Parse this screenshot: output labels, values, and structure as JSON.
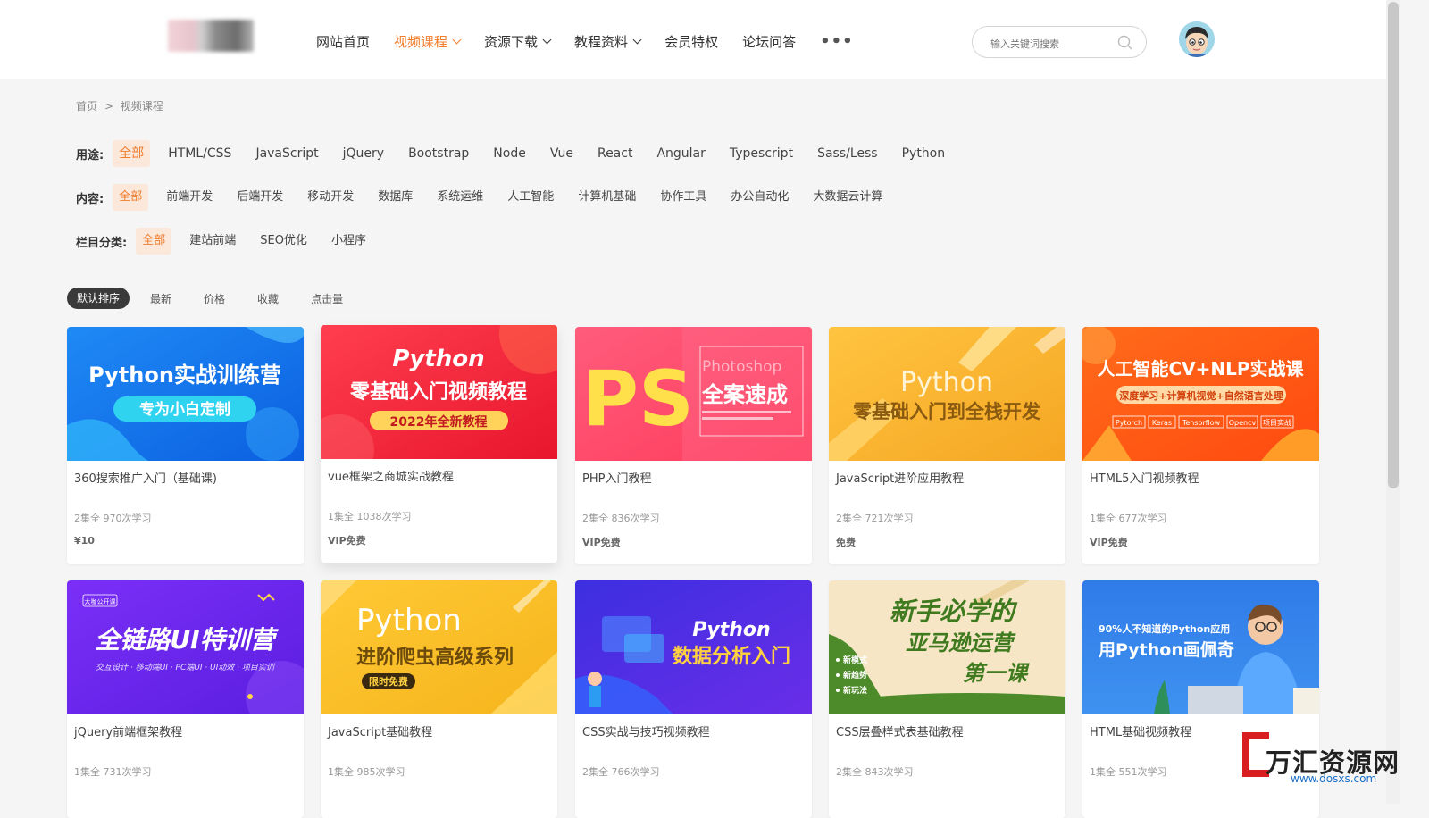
{
  "header": {
    "nav": [
      {
        "label": "网站首页",
        "active": false,
        "dropdown": false
      },
      {
        "label": "视频课程",
        "active": true,
        "dropdown": true
      },
      {
        "label": "资源下载",
        "active": false,
        "dropdown": true
      },
      {
        "label": "教程资料",
        "active": false,
        "dropdown": true
      },
      {
        "label": "会员特权",
        "active": false,
        "dropdown": false
      },
      {
        "label": "论坛问答",
        "active": false,
        "dropdown": false
      }
    ],
    "more_label": "•••",
    "search_placeholder": "输入关键词搜索",
    "accent_color": "#f07c2c"
  },
  "breadcrumb": {
    "home": "首页",
    "separator": ">",
    "current": "视频课程"
  },
  "filters": {
    "usage": {
      "label": "用途:",
      "options": [
        "全部",
        "HTML/CSS",
        "JavaScript",
        "jQuery",
        "Bootstrap",
        "Node",
        "Vue",
        "React",
        "Angular",
        "Typescript",
        "Sass/Less",
        "Python"
      ]
    },
    "content": {
      "label": "内容:",
      "options": [
        "全部",
        "前端开发",
        "后端开发",
        "移动开发",
        "数据库",
        "系统运维",
        "人工智能",
        "计算机基础",
        "协作工具",
        "办公自动化",
        "大数据云计算"
      ]
    },
    "category": {
      "label": "栏目分类:",
      "options": [
        "全部",
        "建站前端",
        "SEO优化",
        "小程序"
      ]
    }
  },
  "sort": [
    "默认排序",
    "最新",
    "价格",
    "收藏",
    "点击量"
  ],
  "cards": [
    {
      "title": "360搜索推广入门（基础课)",
      "meta": "2集全 970次学习",
      "price": "¥10",
      "banner": {
        "lines": [
          "Python实战训练营"
        ],
        "pill": "专为小白定制",
        "theme": "blue"
      }
    },
    {
      "title": "vue框架之商城实战教程",
      "meta": "1集全 1038次学习",
      "price": "VIP免费",
      "banner": {
        "lines": [
          "Python",
          "零基础入门视频教程"
        ],
        "pill": "2022年全新教程",
        "theme": "red"
      }
    },
    {
      "title": "PHP入门教程",
      "meta": "2集全 836次学习",
      "price": "VIP免费",
      "banner": {
        "big": "PS",
        "watermark": "Photoshop",
        "side": "全案速成",
        "theme": "pink"
      }
    },
    {
      "title": "JavaScript进阶应用教程",
      "meta": "2集全 721次学习",
      "price": "免费",
      "banner": {
        "lines": [
          "Python",
          "零基础入门到全栈开发"
        ],
        "theme": "yellow"
      }
    },
    {
      "title": "HTML5入门视频教程",
      "meta": "1集全 677次学习",
      "price": "VIP免费",
      "banner": {
        "lines": [
          "人工智能CV+NLP实战课"
        ],
        "pill": "深度学习+计算机视觉+自然语言处理",
        "tags": [
          "Pytorch",
          "Keras",
          "Tensorflow",
          "Opencv",
          "项目实战"
        ],
        "theme": "orange"
      }
    },
    {
      "title": "jQuery前端框架教程",
      "meta": "1集全 731次学习",
      "price": "",
      "banner": {
        "badge": "大咖公开课",
        "lines": [
          "全链路UI特训营"
        ],
        "sub": "交互设计 · 移动端UI · PC端UI · UI动效 · 项目实训",
        "theme": "purple"
      }
    },
    {
      "title": "JavaScript基础教程",
      "meta": "1集全 985次学习",
      "price": "",
      "banner": {
        "lines": [
          "Python",
          "进阶爬虫高级系列"
        ],
        "pill": "限时免费",
        "theme": "gold"
      }
    },
    {
      "title": "CSS实战与技巧视频教程",
      "meta": "2集全 766次学习",
      "price": "",
      "banner": {
        "lines": [
          "Python",
          "数据分析入门"
        ],
        "theme": "indigo"
      }
    },
    {
      "title": "CSS层叠样式表基础教程",
      "meta": "2集全 843次学习",
      "price": "",
      "banner": {
        "lines": [
          "新手必学的",
          "亚马逊运营",
          "第一课"
        ],
        "bullets": [
          "新模式",
          "新趋势",
          "新玩法"
        ],
        "theme": "cream"
      }
    },
    {
      "title": "HTML基础视频教程",
      "meta": "1集全 551次学习",
      "price": "",
      "banner": {
        "lines": [
          "90%人不知道的Python应用",
          "用Python画佩奇"
        ],
        "theme": "lightblue"
      }
    }
  ],
  "watermark": {
    "text": "万汇资源网",
    "url": "www.dosxs.com"
  }
}
